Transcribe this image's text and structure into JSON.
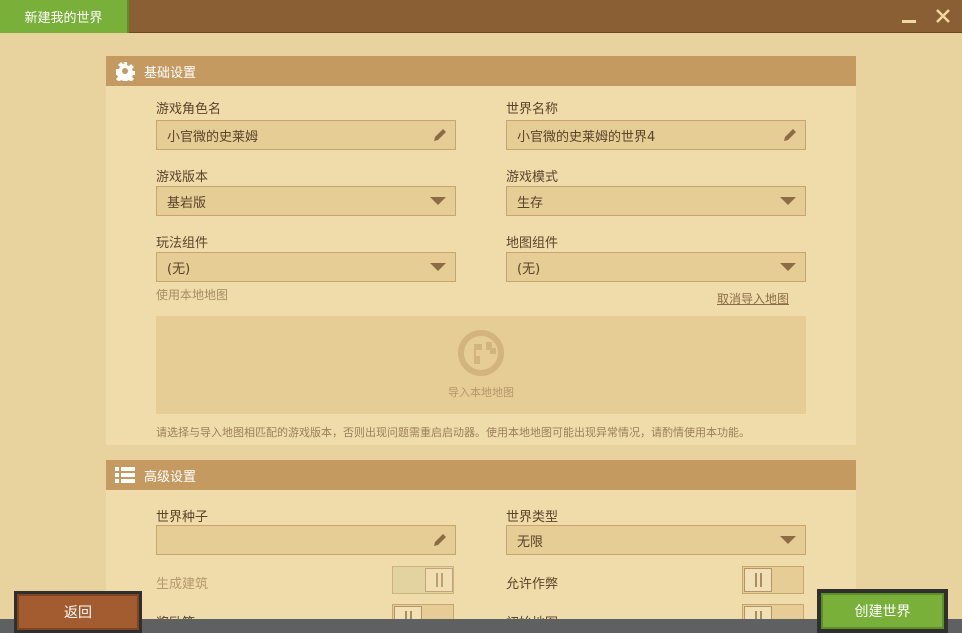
{
  "window": {
    "title": "新建我的世界"
  },
  "basic": {
    "header": "基础设置",
    "role_name_label": "游戏角色名",
    "role_name_value": "小官微的史莱姆",
    "world_name_label": "世界名称",
    "world_name_value": "小官微的史莱姆的世界4",
    "version_label": "游戏版本",
    "version_value": "基岩版",
    "mode_label": "游戏模式",
    "mode_value": "生存",
    "gameplay_label": "玩法组件",
    "gameplay_value": "(无)",
    "map_comp_label": "地图组件",
    "map_comp_value": "(无)",
    "use_local_map": "使用本地地图",
    "cancel_import": "取消导入地图",
    "import_text": "导入本地地图",
    "note": "请选择与导入地图相匹配的游戏版本，否则出现问题需重启启动器。使用本地地图可能出现异常情况，请酌情使用本功能。"
  },
  "advanced": {
    "header": "高级设置",
    "seed_label": "世界种子",
    "seed_value": "",
    "world_type_label": "世界类型",
    "world_type_value": "无限",
    "gen_structures_label": "生成建筑",
    "cheats_label": "允许作弊",
    "bonus_chest_label": "奖励箱",
    "start_map_label": "初始地图"
  },
  "buttons": {
    "back": "返回",
    "create": "创建世界"
  },
  "colors": {
    "accent_green": "#78b03a",
    "back_brown": "#a25c30",
    "header_tan": "#c49a61"
  }
}
